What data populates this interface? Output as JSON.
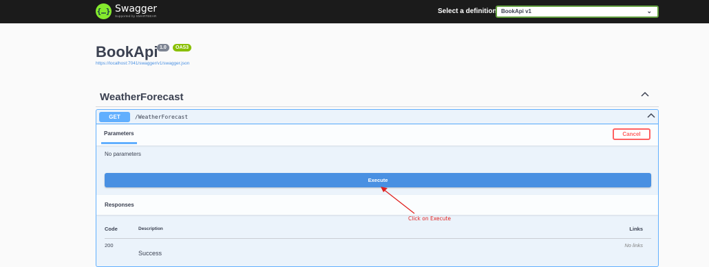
{
  "topbar": {
    "logo_name": "Swagger",
    "logo_sub": "Supported by SMARTBEAR",
    "definition_label": "Select a definition",
    "definition_value": "BookApi v1"
  },
  "info": {
    "title": "BookApi",
    "version": "1.0",
    "oas": "OAS3",
    "spec_url": "https://localhost:7041/swagger/v1/swagger.json"
  },
  "tag": {
    "name": "WeatherForecast"
  },
  "operation": {
    "method": "GET",
    "path": "/WeatherForecast",
    "parameters_tab": "Parameters",
    "cancel_label": "Cancel",
    "no_params": "No parameters",
    "execute_label": "Execute",
    "responses_title": "Responses",
    "columns": {
      "code": "Code",
      "description": "Description",
      "links": "Links"
    },
    "responses": [
      {
        "code": "200",
        "description": "Success",
        "links": "No links"
      }
    ]
  },
  "annotation": {
    "text": "Click on Execute",
    "color": "#e0201e"
  },
  "colors": {
    "topbar": "#1b1b1b",
    "get_method": "#61affe",
    "execute": "#4990e2",
    "cancel": "#ff6060",
    "oas_badge": "#89bf04"
  }
}
